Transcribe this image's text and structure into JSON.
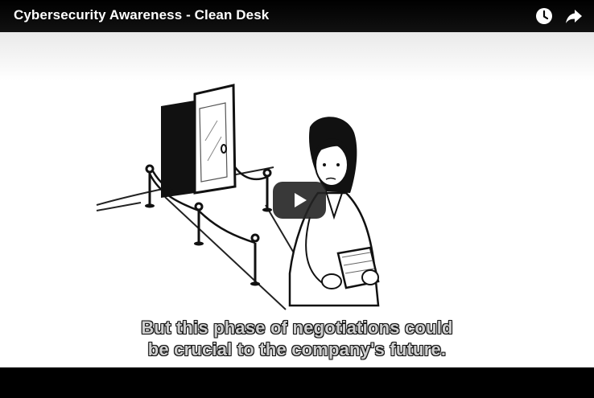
{
  "video": {
    "title": "Cybersecurity Awareness - Clean Desk"
  },
  "icons": {
    "watch_later": "clock-icon",
    "share": "share-icon",
    "play": "play-icon"
  },
  "captions": {
    "line1": "But this phase of negotiations could",
    "line2": "be crucial to the company's future."
  },
  "colors": {
    "topbar": "#000000",
    "play_button": "#232323",
    "caption_text": "#cfcfcf"
  }
}
